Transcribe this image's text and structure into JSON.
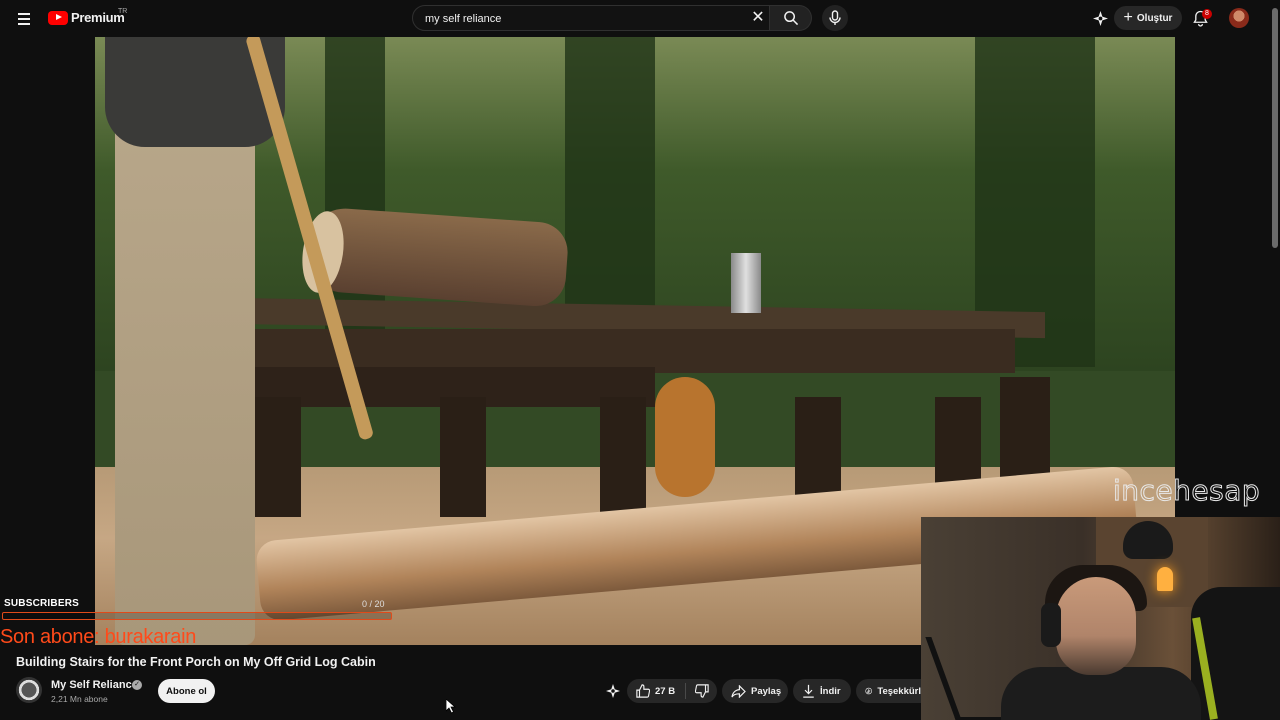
{
  "header": {
    "logo_text": "Premium",
    "country_code": "TR",
    "search_value": "my self reliance",
    "create_label": "Oluştur",
    "notification_count": "8"
  },
  "video": {
    "watermark": "incehesap"
  },
  "overlay": {
    "subscribers_label": "SUBSCRIBERS",
    "subscribers_progress": "0 / 20",
    "subscribers_progress_value": 0,
    "last_subscriber": "Son abone: burakarain"
  },
  "watch": {
    "title": "Building Stairs for the Front Porch on My Off Grid Log Cabin",
    "channel_name": "My Self Reliance",
    "subscriber_count": "2,21 Mn abone",
    "subscribe_label": "Abone ol",
    "like_count": "27 B",
    "share_label": "Paylaş",
    "download_label": "İndir",
    "thanks_label": "Teşekkürl"
  },
  "colors": {
    "brand_red": "#ff0000",
    "overlay_orange": "#ff4a1a",
    "background": "#0f0f0f",
    "pill": "#272727"
  },
  "icons": [
    "menu-icon",
    "youtube-logo-icon",
    "clear-icon",
    "search-icon",
    "mic-icon",
    "ai-sparkle-icon",
    "plus-icon",
    "bell-icon",
    "like-icon",
    "dislike-icon",
    "share-icon",
    "download-icon",
    "thanks-icon",
    "verified-icon"
  ]
}
